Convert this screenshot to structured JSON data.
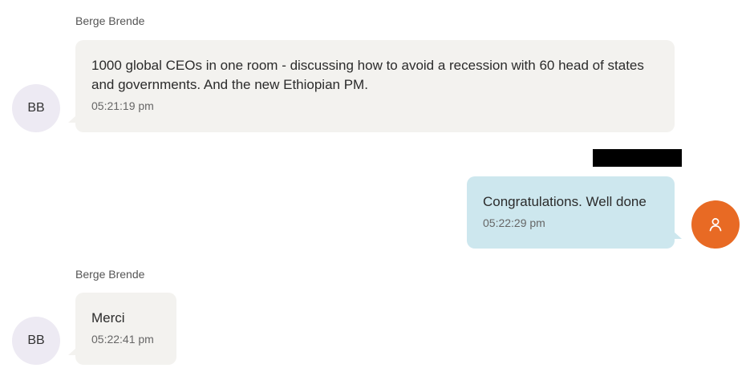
{
  "messages": [
    {
      "direction": "incoming",
      "sender": "Berge Brende",
      "avatar_initials": "BB",
      "text": "1000 global CEOs in one room - discussing how to avoid a recession with 60 head of states and governments. And the new Ethiopian PM.",
      "time": "05:21:19 pm"
    },
    {
      "direction": "outgoing",
      "avatar_icon": "user-icon",
      "text": "Congratulations. Well done",
      "time": "05:22:29 pm"
    },
    {
      "direction": "incoming",
      "sender": "Berge Brende",
      "avatar_initials": "BB",
      "text": "Merci",
      "time": "05:22:41 pm"
    }
  ],
  "colors": {
    "incoming_bubble": "#f3f2ef",
    "outgoing_bubble": "#cde7ee",
    "incoming_avatar": "#edeaf3",
    "outgoing_avatar": "#e86a24",
    "redaction": "#000000"
  }
}
